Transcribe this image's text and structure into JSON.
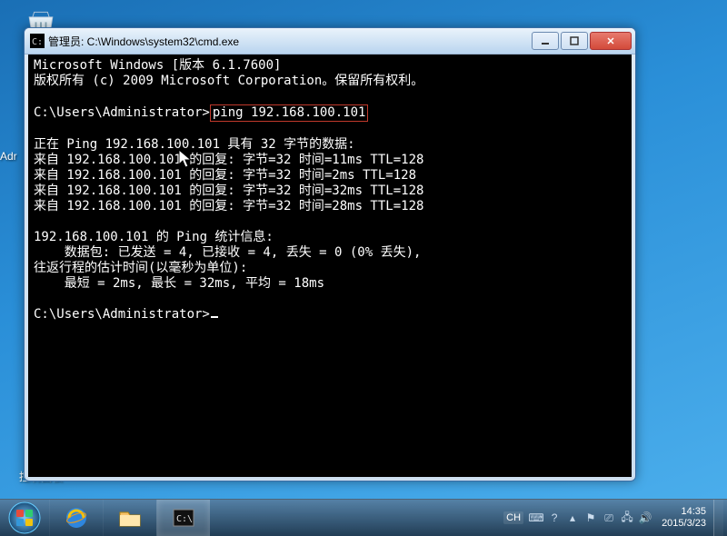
{
  "desktop": {
    "recycle_bin_visible": true,
    "admin_icon_label_partial": "Adr",
    "control_panel_label": "控制面板"
  },
  "window": {
    "title": "管理员: C:\\Windows\\system32\\cmd.exe"
  },
  "console": {
    "line01": "Microsoft Windows [版本 6.1.7600]",
    "line02": "版权所有 (c) 2009 Microsoft Corporation。保留所有权利。",
    "blank1": "",
    "prompt1": "C:\\Users\\Administrator>",
    "command": "ping 192.168.100.101",
    "blank2": "",
    "ping_start": "正在 Ping 192.168.100.101 具有 32 字节的数据:",
    "reply1": "来自 192.168.100.101 的回复: 字节=32 时间=11ms TTL=128",
    "reply2": "来自 192.168.100.101 的回复: 字节=32 时间=2ms TTL=128",
    "reply3": "来自 192.168.100.101 的回复: 字节=32 时间=32ms TTL=128",
    "reply4": "来自 192.168.100.101 的回复: 字节=32 时间=28ms TTL=128",
    "blank3": "",
    "stats_head": "192.168.100.101 的 Ping 统计信息:",
    "stats_pkts": "    数据包: 已发送 = 4, 已接收 = 4, 丢失 = 0 (0% 丢失),",
    "rtt_head": "往返行程的估计时间(以毫秒为单位):",
    "rtt_vals": "    最短 = 2ms, 最长 = 32ms, 平均 = 18ms",
    "blank4": "",
    "prompt2": "C:\\Users\\Administrator>"
  },
  "taskbar": {
    "lang": "CH",
    "clock_time": "14:35",
    "clock_date": "2015/3/23"
  }
}
